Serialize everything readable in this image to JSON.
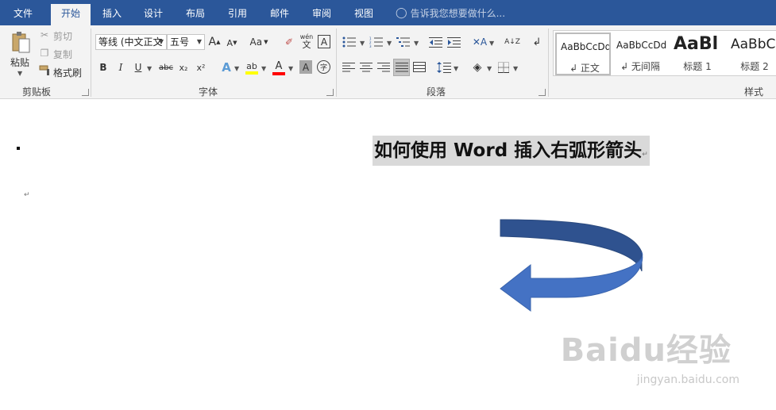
{
  "tabs": [
    {
      "label": "文件"
    },
    {
      "label": "开始"
    },
    {
      "label": "插入"
    },
    {
      "label": "设计"
    },
    {
      "label": "布局"
    },
    {
      "label": "引用"
    },
    {
      "label": "邮件"
    },
    {
      "label": "审阅"
    },
    {
      "label": "视图"
    }
  ],
  "tell_me": "告诉我您想要做什么...",
  "clipboard": {
    "paste": "粘贴",
    "cut": "剪切",
    "copy": "复制",
    "format_painter": "格式刷",
    "label": "剪贴板"
  },
  "font": {
    "family": "等线 (中文正文",
    "size": "五号",
    "bold": "B",
    "italic": "I",
    "underline": "U",
    "strike": "abc",
    "subscript": "x₂",
    "superscript": "x²",
    "grow": "A",
    "shrink": "A",
    "case": "Aa",
    "pinyin_top": "wén",
    "pinyin_bottom": "文",
    "char_border": "A",
    "text_effect": "A",
    "font_color": "A",
    "char_shading": "A",
    "enclose": "字",
    "label": "字体"
  },
  "paragraph": {
    "label": "段落",
    "sort": "A↓Z"
  },
  "styles": {
    "label": "样式",
    "items": [
      {
        "sample": "AaBbCcDd",
        "name": "↲ 正文"
      },
      {
        "sample": "AaBbCcDd",
        "name": "↲ 无间隔"
      },
      {
        "sample": "AaBl",
        "name": "标题 1"
      },
      {
        "sample": "AaBbC",
        "name": "标题 2"
      }
    ]
  },
  "document": {
    "heading": "如何使用 Word 插入右弧形箭头",
    "para_mark": "↵"
  },
  "watermark": {
    "brand": "Baidu经验",
    "url": "jingyan.baidu.com"
  },
  "colors": {
    "tab_bar": "#2b579a",
    "arrow_front": "#4472c4",
    "arrow_back": "#2f528f",
    "highlight_yellow": "#ffff00",
    "font_red": "#ff0000"
  }
}
